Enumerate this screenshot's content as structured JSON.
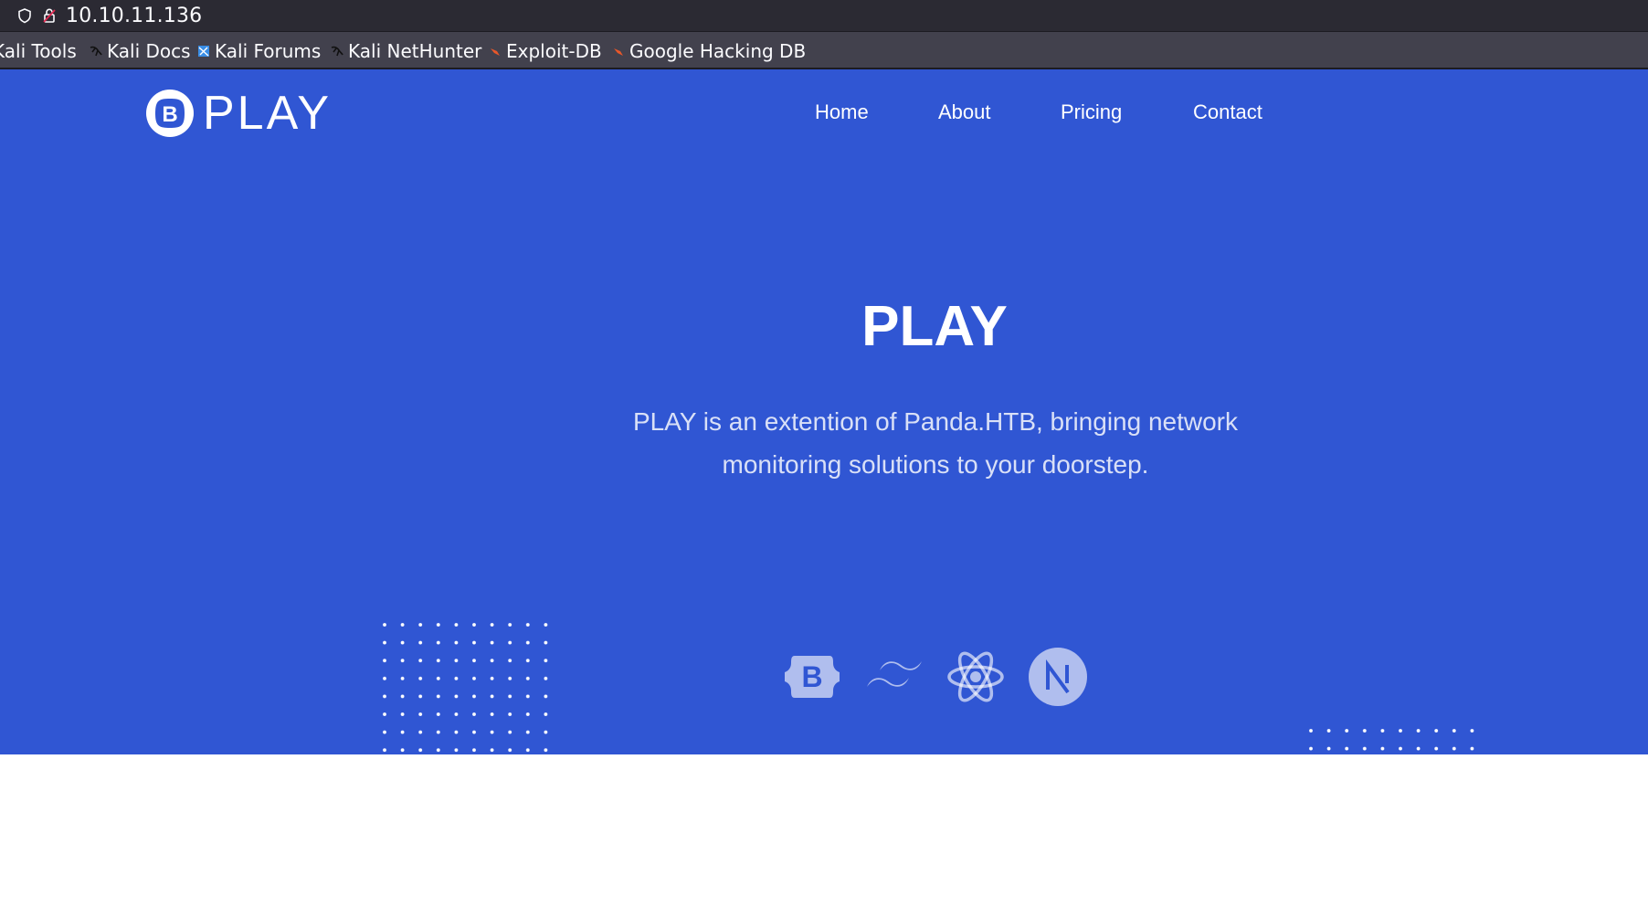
{
  "browser": {
    "url": "10.10.11.136",
    "bookmarks": [
      {
        "label": "Kali Tools",
        "icon": "kali-dragon-icon"
      },
      {
        "label": "Kali Docs",
        "icon": "kali-dragon-icon"
      },
      {
        "label": "Kali Forums",
        "icon": "kali-forums-icon"
      },
      {
        "label": "Kali NetHunter",
        "icon": "kali-dragon-icon"
      },
      {
        "label": "Exploit-DB",
        "icon": "exploit-db-icon"
      },
      {
        "label": "Google Hacking DB",
        "icon": "exploit-db-icon"
      }
    ]
  },
  "site": {
    "brand": "PLAY",
    "nav": [
      "Home",
      "About",
      "Pricing",
      "Contact"
    ],
    "hero": {
      "title": "PLAY",
      "description_line1": "PLAY is an extention of Panda.HTB, bringing network",
      "description_line2": "monitoring solutions to your doorstep."
    },
    "tech_icons": [
      "bootstrap-icon",
      "tailwind-icon",
      "react-icon",
      "nextjs-icon"
    ]
  },
  "colors": {
    "hero_bg": "#3056d3",
    "url_bar_bg": "#2b2a33",
    "bookmarks_bg": "#42414d",
    "text_white": "#ffffff"
  }
}
